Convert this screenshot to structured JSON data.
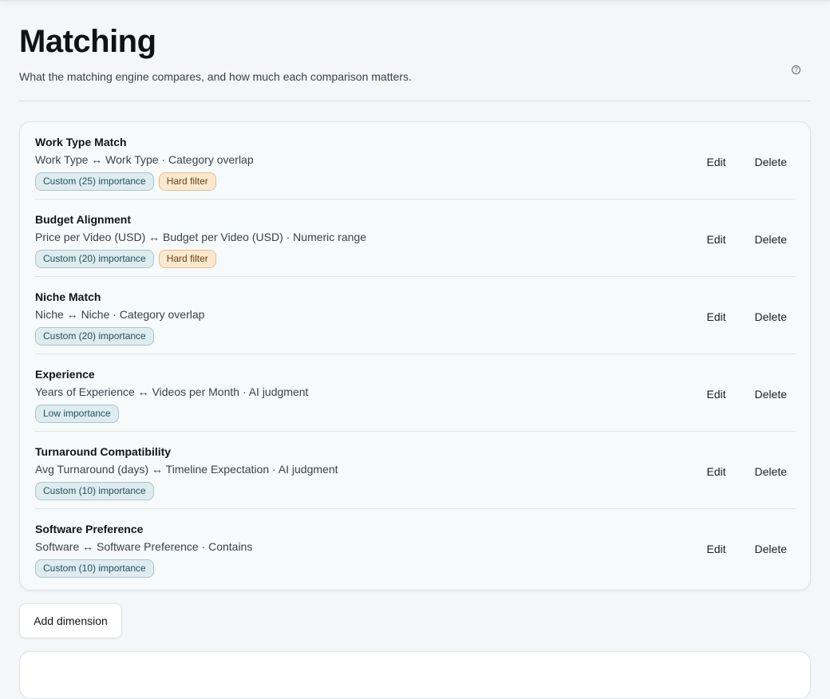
{
  "header": {
    "title": "Matching",
    "subtitle": "What the matching engine compares, and how much each comparison matters.",
    "help_icon": "question-circle-icon"
  },
  "dimensions": [
    {
      "title": "Work Type Match",
      "description": "Work Type ↔ Work Type · Category overlap",
      "badges": [
        {
          "type": "importance",
          "label": "Custom (25) importance"
        },
        {
          "type": "hard",
          "label": "Hard filter"
        }
      ]
    },
    {
      "title": "Budget Alignment",
      "description": "Price per Video (USD) ↔ Budget per Video (USD) · Numeric range",
      "badges": [
        {
          "type": "importance",
          "label": "Custom (20) importance"
        },
        {
          "type": "hard",
          "label": "Hard filter"
        }
      ]
    },
    {
      "title": "Niche Match",
      "description": "Niche ↔ Niche · Category overlap",
      "badges": [
        {
          "type": "importance",
          "label": "Custom (20) importance"
        }
      ]
    },
    {
      "title": "Experience",
      "description": "Years of Experience ↔ Videos per Month · AI judgment",
      "badges": [
        {
          "type": "importance",
          "label": "Low importance"
        }
      ]
    },
    {
      "title": "Turnaround Compatibility",
      "description": "Avg Turnaround (days) ↔ Timeline Expectation · AI judgment",
      "badges": [
        {
          "type": "importance",
          "label": "Custom (10) importance"
        }
      ]
    },
    {
      "title": "Software Preference",
      "description": "Software ↔ Software Preference · Contains",
      "badges": [
        {
          "type": "importance",
          "label": "Custom (10) importance"
        }
      ]
    }
  ],
  "actions": {
    "edit_label": "Edit",
    "delete_label": "Delete"
  },
  "add_button_label": "Add dimension",
  "colors": {
    "importance_badge_bg": "#dfecef",
    "hard_filter_badge_bg": "#fbe9cf",
    "page_bg": "#f4f6f7"
  }
}
